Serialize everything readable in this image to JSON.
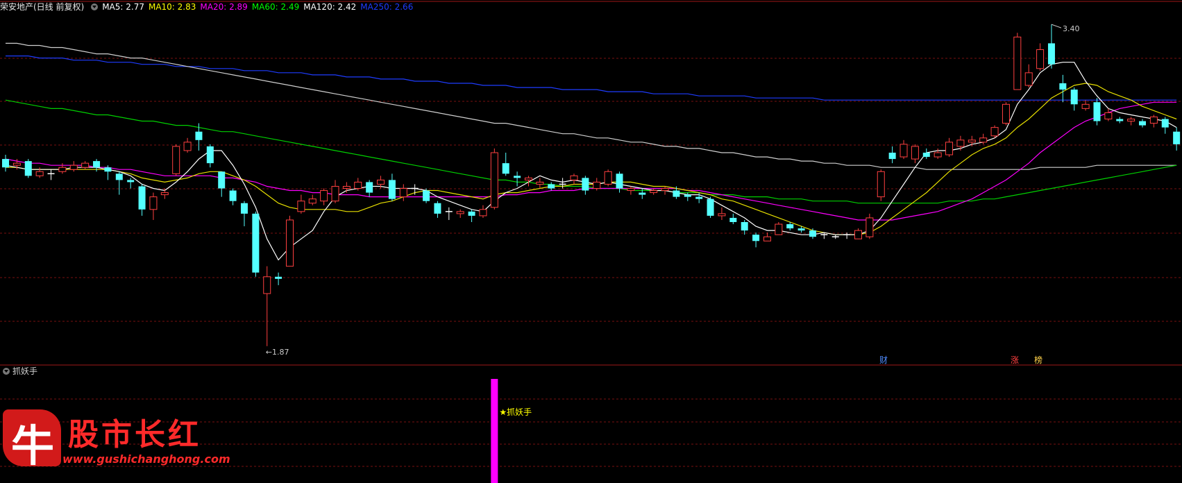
{
  "header": {
    "stock_title": "荣安地产(日线 前复权)",
    "ma_labels": [
      {
        "text": "MA5: 2.77",
        "color": "#ffffff"
      },
      {
        "text": "MA10: 2.83",
        "color": "#ffff00"
      },
      {
        "text": "MA20: 2.89",
        "color": "#ff00ff"
      },
      {
        "text": "MA60: 2.49",
        "color": "#00ff00"
      },
      {
        "text": "MA120: 2.42",
        "color": "#ffffff"
      },
      {
        "text": "MA250: 2.66",
        "color": "#1e3cff"
      }
    ]
  },
  "indicator": {
    "title": "抓妖手",
    "signal_label": "★抓妖手"
  },
  "annotations": {
    "high_label": "3.40",
    "low_label": "←1.87",
    "event_marks": [
      {
        "text": "财",
        "color": "#4f8cff"
      },
      {
        "text": "涨",
        "color": "#ff4040"
      },
      {
        "text": "榜",
        "color": "#ffd24a"
      }
    ]
  },
  "watermark": {
    "logo_char": "牛",
    "title": "股市长红",
    "url": "www.gushichanghong.com"
  },
  "colors": {
    "up": "#ff4040",
    "down": "#54ffff",
    "grid": "#7a1010",
    "signal": "#ff00ff"
  },
  "chart_data": {
    "type": "candlestick",
    "y_range": [
      1.8,
      3.45
    ],
    "high": 3.4,
    "low": 1.87,
    "candles": [
      [
        2.76,
        2.72,
        2.78,
        2.7
      ],
      [
        2.73,
        2.74,
        2.76,
        2.71
      ],
      [
        2.75,
        2.68,
        2.76,
        2.67
      ],
      [
        2.68,
        2.7,
        2.72,
        2.67
      ],
      [
        2.69,
        2.69,
        2.71,
        2.66
      ],
      [
        2.7,
        2.72,
        2.74,
        2.69
      ],
      [
        2.71,
        2.73,
        2.75,
        2.7
      ],
      [
        2.72,
        2.74,
        2.75,
        2.71
      ],
      [
        2.75,
        2.72,
        2.76,
        2.7
      ],
      [
        2.72,
        2.7,
        2.73,
        2.66
      ],
      [
        2.69,
        2.66,
        2.7,
        2.59
      ],
      [
        2.66,
        2.65,
        2.67,
        2.62
      ],
      [
        2.63,
        2.52,
        2.64,
        2.49
      ],
      [
        2.52,
        2.58,
        2.6,
        2.47
      ],
      [
        2.59,
        2.6,
        2.62,
        2.57
      ],
      [
        2.69,
        2.82,
        2.83,
        2.68
      ],
      [
        2.8,
        2.84,
        2.86,
        2.79
      ],
      [
        2.89,
        2.85,
        2.93,
        2.8
      ],
      [
        2.82,
        2.74,
        2.83,
        2.72
      ],
      [
        2.7,
        2.62,
        2.7,
        2.58
      ],
      [
        2.61,
        2.56,
        2.62,
        2.54
      ],
      [
        2.55,
        2.5,
        2.56,
        2.44
      ],
      [
        2.5,
        2.22,
        2.51,
        2.2
      ],
      [
        2.12,
        2.2,
        2.25,
        1.87
      ],
      [
        2.2,
        2.19,
        2.22,
        2.16
      ],
      [
        2.25,
        2.47,
        2.49,
        2.25
      ],
      [
        2.51,
        2.56,
        2.59,
        2.5
      ],
      [
        2.55,
        2.57,
        2.59,
        2.54
      ],
      [
        2.56,
        2.61,
        2.62,
        2.54
      ],
      [
        2.56,
        2.63,
        2.66,
        2.55
      ],
      [
        2.62,
        2.63,
        2.65,
        2.6
      ],
      [
        2.62,
        2.65,
        2.67,
        2.61
      ],
      [
        2.65,
        2.6,
        2.66,
        2.58
      ],
      [
        2.64,
        2.66,
        2.68,
        2.62
      ],
      [
        2.66,
        2.57,
        2.69,
        2.56
      ],
      [
        2.58,
        2.62,
        2.64,
        2.56
      ],
      [
        2.62,
        2.62,
        2.64,
        2.59
      ],
      [
        2.61,
        2.56,
        2.62,
        2.55
      ],
      [
        2.55,
        2.5,
        2.56,
        2.48
      ],
      [
        2.51,
        2.51,
        2.53,
        2.47
      ],
      [
        2.5,
        2.51,
        2.52,
        2.48
      ],
      [
        2.51,
        2.49,
        2.52,
        2.46
      ],
      [
        2.49,
        2.52,
        2.54,
        2.48
      ],
      [
        2.53,
        2.79,
        2.81,
        2.52
      ],
      [
        2.74,
        2.69,
        2.79,
        2.68
      ],
      [
        2.68,
        2.67,
        2.7,
        2.63
      ],
      [
        2.66,
        2.67,
        2.68,
        2.63
      ],
      [
        2.64,
        2.65,
        2.67,
        2.62
      ],
      [
        2.64,
        2.62,
        2.65,
        2.61
      ],
      [
        2.64,
        2.64,
        2.67,
        2.62
      ],
      [
        2.66,
        2.68,
        2.69,
        2.64
      ],
      [
        2.67,
        2.61,
        2.68,
        2.59
      ],
      [
        2.62,
        2.65,
        2.67,
        2.61
      ],
      [
        2.64,
        2.7,
        2.71,
        2.63
      ],
      [
        2.69,
        2.62,
        2.7,
        2.6
      ],
      [
        2.61,
        2.62,
        2.63,
        2.59
      ],
      [
        2.6,
        2.59,
        2.62,
        2.57
      ],
      [
        2.6,
        2.61,
        2.62,
        2.59
      ],
      [
        2.61,
        2.62,
        2.63,
        2.59
      ],
      [
        2.61,
        2.58,
        2.63,
        2.57
      ],
      [
        2.59,
        2.58,
        2.6,
        2.56
      ],
      [
        2.58,
        2.57,
        2.6,
        2.55
      ],
      [
        2.57,
        2.49,
        2.58,
        2.48
      ],
      [
        2.49,
        2.5,
        2.53,
        2.47
      ],
      [
        2.48,
        2.46,
        2.5,
        2.45
      ],
      [
        2.46,
        2.42,
        2.47,
        2.4
      ],
      [
        2.4,
        2.37,
        2.41,
        2.34
      ],
      [
        2.37,
        2.39,
        2.41,
        2.37
      ],
      [
        2.4,
        2.45,
        2.46,
        2.4
      ],
      [
        2.45,
        2.43,
        2.46,
        2.42
      ],
      [
        2.43,
        2.42,
        2.44,
        2.41
      ],
      [
        2.42,
        2.39,
        2.43,
        2.38
      ],
      [
        2.4,
        2.4,
        2.41,
        2.38
      ],
      [
        2.39,
        2.39,
        2.4,
        2.38
      ],
      [
        2.4,
        2.4,
        2.41,
        2.38
      ],
      [
        2.38,
        2.42,
        2.43,
        2.38
      ],
      [
        2.39,
        2.48,
        2.5,
        2.38
      ],
      [
        2.58,
        2.7,
        2.71,
        2.56
      ],
      [
        2.79,
        2.76,
        2.82,
        2.74
      ],
      [
        2.77,
        2.83,
        2.85,
        2.76
      ],
      [
        2.76,
        2.82,
        2.83,
        2.74
      ],
      [
        2.79,
        2.77,
        2.81,
        2.76
      ],
      [
        2.77,
        2.79,
        2.81,
        2.76
      ],
      [
        2.78,
        2.84,
        2.86,
        2.77
      ],
      [
        2.82,
        2.85,
        2.87,
        2.8
      ],
      [
        2.84,
        2.85,
        2.87,
        2.82
      ],
      [
        2.84,
        2.86,
        2.88,
        2.83
      ],
      [
        2.87,
        2.91,
        2.92,
        2.86
      ],
      [
        2.93,
        3.02,
        3.03,
        2.92
      ],
      [
        3.09,
        3.34,
        3.36,
        3.09
      ],
      [
        3.11,
        3.17,
        3.21,
        3.1
      ],
      [
        3.19,
        3.28,
        3.31,
        3.18
      ],
      [
        3.31,
        3.21,
        3.4,
        3.19
      ],
      [
        3.12,
        3.09,
        3.16,
        3.03
      ],
      [
        3.09,
        3.02,
        3.1,
        2.99
      ],
      [
        3.0,
        3.02,
        3.04,
        2.99
      ],
      [
        3.03,
        2.94,
        3.05,
        2.92
      ],
      [
        2.95,
        2.98,
        3.0,
        2.94
      ],
      [
        2.95,
        2.94,
        2.96,
        2.93
      ],
      [
        2.94,
        2.95,
        2.96,
        2.92
      ],
      [
        2.94,
        2.92,
        2.95,
        2.91
      ],
      [
        2.93,
        2.96,
        2.97,
        2.91
      ],
      [
        2.95,
        2.91,
        2.96,
        2.88
      ],
      [
        2.89,
        2.83,
        2.91,
        2.8
      ]
    ],
    "ma5": [
      2.73,
      2.72,
      2.71,
      2.71,
      2.71,
      2.71,
      2.72,
      2.72,
      2.72,
      2.71,
      2.7,
      2.68,
      2.64,
      2.62,
      2.61,
      2.65,
      2.7,
      2.76,
      2.8,
      2.8,
      2.73,
      2.64,
      2.53,
      2.38,
      2.28,
      2.34,
      2.38,
      2.42,
      2.51,
      2.58,
      2.61,
      2.62,
      2.63,
      2.63,
      2.62,
      2.62,
      2.62,
      2.61,
      2.58,
      2.56,
      2.54,
      2.52,
      2.51,
      2.56,
      2.6,
      2.62,
      2.65,
      2.68,
      2.66,
      2.65,
      2.66,
      2.65,
      2.64,
      2.65,
      2.64,
      2.63,
      2.62,
      2.61,
      2.61,
      2.6,
      2.59,
      2.59,
      2.57,
      2.54,
      2.51,
      2.48,
      2.44,
      2.42,
      2.42,
      2.41,
      2.4,
      2.4,
      2.41,
      2.4,
      2.4,
      2.4,
      2.42,
      2.48,
      2.56,
      2.64,
      2.72,
      2.79,
      2.8,
      2.8,
      2.81,
      2.83,
      2.84,
      2.86,
      2.9,
      3.02,
      3.09,
      3.17,
      3.21,
      3.22,
      3.22,
      3.13,
      3.06,
      3.0,
      2.98,
      2.97,
      2.96,
      2.95,
      2.94,
      2.91
    ],
    "ma10": [
      2.72,
      2.72,
      2.71,
      2.71,
      2.71,
      2.71,
      2.71,
      2.71,
      2.71,
      2.71,
      2.7,
      2.69,
      2.67,
      2.66,
      2.65,
      2.66,
      2.67,
      2.69,
      2.7,
      2.7,
      2.68,
      2.66,
      2.63,
      2.59,
      2.55,
      2.53,
      2.52,
      2.52,
      2.52,
      2.52,
      2.51,
      2.51,
      2.53,
      2.55,
      2.56,
      2.58,
      2.6,
      2.61,
      2.61,
      2.6,
      2.59,
      2.58,
      2.57,
      2.59,
      2.6,
      2.6,
      2.61,
      2.62,
      2.63,
      2.63,
      2.64,
      2.64,
      2.64,
      2.65,
      2.65,
      2.65,
      2.64,
      2.63,
      2.63,
      2.62,
      2.61,
      2.6,
      2.59,
      2.57,
      2.56,
      2.54,
      2.52,
      2.5,
      2.48,
      2.46,
      2.44,
      2.42,
      2.41,
      2.4,
      2.4,
      2.4,
      2.41,
      2.44,
      2.48,
      2.52,
      2.56,
      2.6,
      2.65,
      2.7,
      2.74,
      2.78,
      2.81,
      2.83,
      2.86,
      2.91,
      2.95,
      3.0,
      3.05,
      3.08,
      3.11,
      3.12,
      3.11,
      3.08,
      3.06,
      3.04,
      3.01,
      2.99,
      2.97,
      2.95
    ],
    "ma20": [
      2.76,
      2.75,
      2.74,
      2.74,
      2.73,
      2.73,
      2.73,
      2.73,
      2.72,
      2.72,
      2.71,
      2.71,
      2.7,
      2.69,
      2.68,
      2.68,
      2.68,
      2.68,
      2.68,
      2.67,
      2.67,
      2.66,
      2.65,
      2.63,
      2.62,
      2.61,
      2.61,
      2.6,
      2.6,
      2.59,
      2.59,
      2.59,
      2.58,
      2.58,
      2.58,
      2.58,
      2.58,
      2.58,
      2.58,
      2.58,
      2.58,
      2.58,
      2.58,
      2.58,
      2.59,
      2.59,
      2.6,
      2.6,
      2.61,
      2.61,
      2.61,
      2.62,
      2.62,
      2.62,
      2.62,
      2.62,
      2.62,
      2.62,
      2.62,
      2.62,
      2.61,
      2.61,
      2.6,
      2.59,
      2.58,
      2.57,
      2.56,
      2.55,
      2.54,
      2.53,
      2.52,
      2.51,
      2.5,
      2.49,
      2.48,
      2.47,
      2.47,
      2.47,
      2.47,
      2.48,
      2.49,
      2.5,
      2.51,
      2.53,
      2.55,
      2.57,
      2.6,
      2.63,
      2.66,
      2.7,
      2.74,
      2.79,
      2.83,
      2.87,
      2.91,
      2.94,
      2.96,
      2.98,
      3.0,
      3.01,
      3.02,
      3.03,
      3.03,
      3.03
    ],
    "ma60": [
      3.04,
      3.03,
      3.02,
      3.01,
      3.0,
      3.0,
      2.99,
      2.98,
      2.97,
      2.97,
      2.96,
      2.95,
      2.94,
      2.94,
      2.93,
      2.92,
      2.92,
      2.91,
      2.9,
      2.89,
      2.89,
      2.88,
      2.87,
      2.86,
      2.85,
      2.84,
      2.83,
      2.82,
      2.81,
      2.8,
      2.79,
      2.78,
      2.77,
      2.76,
      2.75,
      2.74,
      2.73,
      2.72,
      2.71,
      2.7,
      2.69,
      2.68,
      2.67,
      2.66,
      2.66,
      2.65,
      2.65,
      2.64,
      2.64,
      2.63,
      2.63,
      2.63,
      2.62,
      2.62,
      2.62,
      2.61,
      2.61,
      2.61,
      2.61,
      2.6,
      2.6,
      2.6,
      2.59,
      2.59,
      2.59,
      2.58,
      2.58,
      2.58,
      2.57,
      2.57,
      2.57,
      2.56,
      2.56,
      2.56,
      2.56,
      2.55,
      2.55,
      2.55,
      2.55,
      2.55,
      2.55,
      2.55,
      2.55,
      2.56,
      2.56,
      2.56,
      2.57,
      2.57,
      2.58,
      2.59,
      2.6,
      2.61,
      2.62,
      2.63,
      2.64,
      2.65,
      2.66,
      2.67,
      2.68,
      2.69,
      2.7,
      2.71,
      2.72,
      2.73
    ],
    "ma120": [
      3.31,
      3.31,
      3.3,
      3.3,
      3.29,
      3.29,
      3.28,
      3.27,
      3.26,
      3.26,
      3.25,
      3.24,
      3.24,
      3.23,
      3.22,
      3.21,
      3.2,
      3.19,
      3.18,
      3.17,
      3.16,
      3.15,
      3.14,
      3.13,
      3.12,
      3.11,
      3.1,
      3.09,
      3.08,
      3.07,
      3.06,
      3.05,
      3.04,
      3.03,
      3.02,
      3.01,
      3.0,
      2.99,
      2.98,
      2.97,
      2.96,
      2.95,
      2.94,
      2.93,
      2.93,
      2.92,
      2.91,
      2.9,
      2.89,
      2.88,
      2.88,
      2.87,
      2.86,
      2.86,
      2.85,
      2.84,
      2.84,
      2.83,
      2.82,
      2.82,
      2.81,
      2.81,
      2.8,
      2.79,
      2.79,
      2.78,
      2.77,
      2.77,
      2.76,
      2.76,
      2.75,
      2.75,
      2.74,
      2.74,
      2.73,
      2.73,
      2.73,
      2.72,
      2.72,
      2.72,
      2.72,
      2.71,
      2.71,
      2.71,
      2.71,
      2.71,
      2.71,
      2.71,
      2.71,
      2.71,
      2.71,
      2.72,
      2.72,
      2.72,
      2.72,
      2.72,
      2.73,
      2.73,
      2.73,
      2.73,
      2.73,
      2.73,
      2.73,
      2.73
    ],
    "ma250": [
      3.25,
      3.25,
      3.25,
      3.24,
      3.24,
      3.24,
      3.23,
      3.23,
      3.23,
      3.22,
      3.22,
      3.22,
      3.21,
      3.21,
      3.21,
      3.2,
      3.2,
      3.2,
      3.19,
      3.19,
      3.19,
      3.18,
      3.18,
      3.18,
      3.17,
      3.17,
      3.17,
      3.16,
      3.16,
      3.16,
      3.15,
      3.15,
      3.15,
      3.14,
      3.14,
      3.14,
      3.13,
      3.13,
      3.13,
      3.12,
      3.12,
      3.12,
      3.11,
      3.11,
      3.11,
      3.1,
      3.1,
      3.1,
      3.1,
      3.09,
      3.09,
      3.09,
      3.09,
      3.08,
      3.08,
      3.08,
      3.08,
      3.07,
      3.07,
      3.07,
      3.07,
      3.06,
      3.06,
      3.06,
      3.06,
      3.06,
      3.05,
      3.05,
      3.05,
      3.05,
      3.05,
      3.05,
      3.04,
      3.04,
      3.04,
      3.04,
      3.04,
      3.04,
      3.04,
      3.04,
      3.04,
      3.04,
      3.04,
      3.04,
      3.04,
      3.04,
      3.04,
      3.04,
      3.04,
      3.04,
      3.04,
      3.04,
      3.04,
      3.04,
      3.04,
      3.04,
      3.04,
      3.04,
      3.04,
      3.04,
      3.04,
      3.04,
      3.04,
      3.04
    ],
    "signal_index": 43
  }
}
